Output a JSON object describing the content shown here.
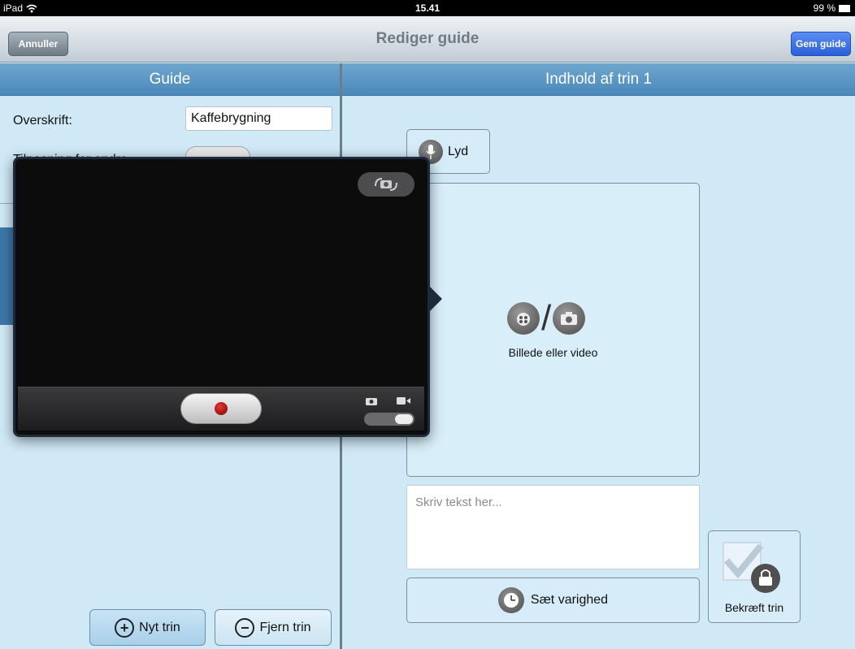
{
  "statusbar": {
    "device": "iPad",
    "time": "15.41",
    "battery": "99 %"
  },
  "navbar": {
    "title": "Rediger guide",
    "cancel_label": "Annuller",
    "save_label": "Gem guide"
  },
  "left_panel": {
    "header": "Guide",
    "heading_label": "Overskrift:",
    "heading_value": "Kaffebrygning",
    "adjust_label": "Tilpasning for andre",
    "add_step_label": "Nyt trin",
    "remove_step_label": "Fjern trin"
  },
  "right_panel": {
    "header": "Indhold af trin 1",
    "sound_label": "Lyd",
    "media_label": "Billede eller video",
    "text_placeholder": "Skriv tekst her...",
    "duration_label": "Sæt varighed",
    "confirm_label": "Bekræft trin"
  },
  "camera": {
    "mode": "photo/video"
  },
  "icons": [
    "wifi-icon",
    "battery-icon",
    "plus-circle-icon",
    "minus-circle-icon",
    "microphone-icon",
    "video-reel-icon",
    "camera-icon",
    "clock-icon",
    "checkbox-lock-icon",
    "camera-flip-icon",
    "record-icon"
  ]
}
